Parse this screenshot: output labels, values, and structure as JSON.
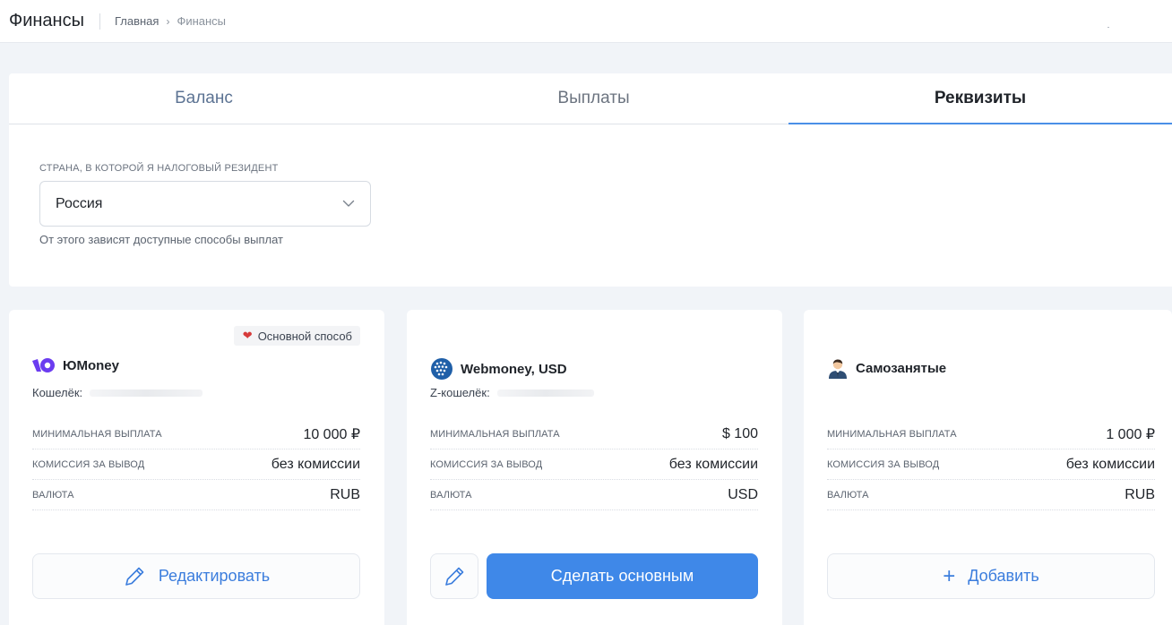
{
  "header": {
    "title": "Финансы",
    "breadcrumb": [
      "Главная",
      "Финансы"
    ]
  },
  "tabs": [
    {
      "label": "Баланс",
      "active": false
    },
    {
      "label": "Выплаты",
      "active": false
    },
    {
      "label": "Реквизиты",
      "active": true
    }
  ],
  "country": {
    "label": "СТРАНА, В КОТОРОЙ Я НАЛОГОВЫЙ РЕЗИДЕНТ",
    "value": "Россия",
    "hint": "От этого зависят доступные способы выплат"
  },
  "colors": {
    "accent": "#3f88e8",
    "tab_underline": "#4a8fe7",
    "heart": "#d63b3b",
    "yoomoney": "#6b3cf0"
  },
  "methods": [
    {
      "name": "ЮMoney",
      "icon": "yoomoney-logo-icon",
      "badge": "Основной способ",
      "wallet_label": "Кошелёк:",
      "rows": [
        {
          "key": "МИНИМАЛЬНАЯ ВЫПЛАТА",
          "value": "10 000 ₽"
        },
        {
          "key": "КОМИССИЯ ЗА ВЫВОД",
          "value": "без комиссии"
        },
        {
          "key": "ВАЛЮТА",
          "value": "RUB"
        }
      ],
      "action": "Редактировать"
    },
    {
      "name": "Webmoney, USD",
      "icon": "webmoney-globe-icon",
      "wallet_label": "Z-кошелёк:",
      "rows": [
        {
          "key": "МИНИМАЛЬНАЯ ВЫПЛАТА",
          "value": "$ 100"
        },
        {
          "key": "КОМИССИЯ ЗА ВЫВОД",
          "value": "без комиссии"
        },
        {
          "key": "ВАЛЮТА",
          "value": "USD"
        }
      ],
      "action": "Сделать основным"
    },
    {
      "name": "Самозанятые",
      "icon": "businessman-icon",
      "rows": [
        {
          "key": "МИНИМАЛЬНАЯ ВЫПЛАТА",
          "value": "1 000 ₽"
        },
        {
          "key": "КОМИССИЯ ЗА ВЫВОД",
          "value": "без комиссии"
        },
        {
          "key": "ВАЛЮТА",
          "value": "RUB"
        }
      ],
      "action": "Добавить"
    }
  ]
}
